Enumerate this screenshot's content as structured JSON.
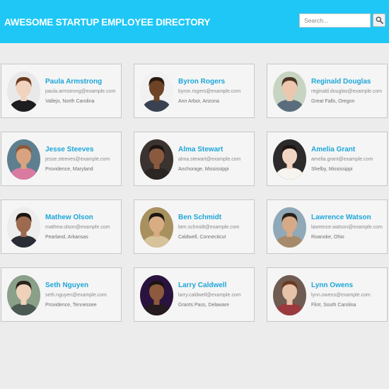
{
  "header": {
    "title": "AWESOME STARTUP EMPLOYEE DIRECTORY",
    "accent_color": "#1ec7f6"
  },
  "search": {
    "placeholder": "Search...",
    "button_icon": "magnifier-icon"
  },
  "employees": [
    {
      "name": "Paula Armstrong",
      "email": "paula.armstrong@example.com",
      "location": "Vallejo, North Carolina",
      "skin": "#f1d3bf",
      "hair": "#6b3a1f",
      "shirt": "#1d1d1f",
      "bg": "#e9e9e9"
    },
    {
      "name": "Byron Rogers",
      "email": "byron.rogers@example.com",
      "location": "Ann Arbor, Arizona",
      "skin": "#6e4326",
      "hair": "#2a1a10",
      "shirt": "#3a4150",
      "bg": "#f1f1f1"
    },
    {
      "name": "Reginald Douglas",
      "email": "reginald.douglas@example.com",
      "location": "Great Falls, Oregon",
      "skin": "#ecc6ad",
      "hair": "#4a3526",
      "shirt": "#5b6d7c",
      "bg": "#c8d4c2"
    },
    {
      "name": "Jesse Steeves",
      "email": "jesse.steeves@example.com",
      "location": "Providence, Maryland",
      "skin": "#d9a37f",
      "hair": "#8b5a3c",
      "shirt": "#d97aa1",
      "bg": "#5e7f8f"
    },
    {
      "name": "Alma Stewart",
      "email": "alma.stewart@example.com",
      "location": "Anchorage, Mississippi",
      "skin": "#8a5a3f",
      "hair": "#1b1512",
      "shirt": "#2b2523",
      "bg": "#3b3330"
    },
    {
      "name": "Amelia Grant",
      "email": "amelia.grant@example.com",
      "location": "Shelby, Mississippi",
      "skin": "#f2d6c4",
      "hair": "#1e1613",
      "shirt": "#f7f4f0",
      "bg": "#2c2a2a"
    },
    {
      "name": "Mathew Olson",
      "email": "mathew.olson@example.com",
      "location": "Pearland, Arkansas",
      "skin": "#9c6a4e",
      "hair": "#1c1511",
      "shirt": "#2a2c36",
      "bg": "#ededed"
    },
    {
      "name": "Ben Schmidt",
      "email": "ben.schmidt@example.com",
      "location": "Caldwell, Connecticut",
      "skin": "#d8ad84",
      "hair": "#1b1713",
      "shirt": "#d6c29b",
      "bg": "#a8915f"
    },
    {
      "name": "Lawrence Watson",
      "email": "lawrence.watson@example.com",
      "location": "Roanoke, Ohio",
      "skin": "#d6a987",
      "hair": "#2b221b",
      "shirt": "#a68a6b",
      "bg": "#8fa9b8"
    },
    {
      "name": "Seth Nguyen",
      "email": "seth.nguyen@example.com",
      "location": "Providence, Tennessee",
      "skin": "#efd2b9",
      "hair": "#2c241c",
      "shirt": "#4a5a52",
      "bg": "#8aa089"
    },
    {
      "name": "Larry Caldwell",
      "email": "larry.caldwell@example.com",
      "location": "Grants Pass, Delaware",
      "skin": "#8d5a3d",
      "hair": "#1a1411",
      "shirt": "#241a1f",
      "bg": "#2b1340"
    },
    {
      "name": "Lynn Owens",
      "email": "lynn.owens@example.com",
      "location": "Flint, South Carolina",
      "skin": "#e6c2a9",
      "hair": "#6a3a22",
      "shirt": "#9a3a3d",
      "bg": "#6f5b52"
    }
  ]
}
